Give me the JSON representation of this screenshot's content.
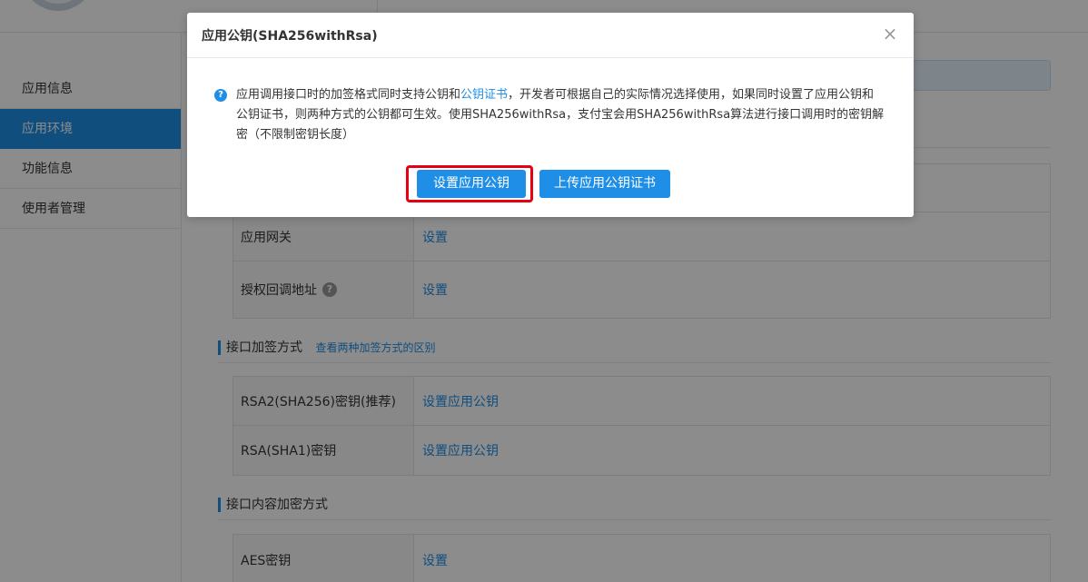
{
  "sidebar": {
    "items": [
      {
        "label": "应用信息",
        "active": false
      },
      {
        "label": "应用环境",
        "active": true
      },
      {
        "label": "功能信息",
        "active": false
      },
      {
        "label": "使用者管理",
        "active": false
      }
    ]
  },
  "main": {
    "gateway_row": {
      "key": "应用网关",
      "value": "设置"
    },
    "callback_row": {
      "key": "授权回调地址",
      "value": "设置",
      "help_icon": "?"
    },
    "sign_section": {
      "title": "接口加签方式",
      "link": "查看两种加签方式的区别",
      "rows": [
        {
          "key": "RSA2(SHA256)密钥(推荐)",
          "value": "设置应用公钥"
        },
        {
          "key": "RSA(SHA1)密钥",
          "value": "设置应用公钥"
        }
      ]
    },
    "encrypt_section": {
      "title": "接口内容加密方式",
      "rows": [
        {
          "key": "AES密钥",
          "value": "设置"
        }
      ]
    }
  },
  "modal": {
    "title": "应用公钥(SHA256withRsa)",
    "close_icon": "×",
    "info_icon": "?",
    "text_before_link": "应用调用接口时的加签格式同时支持公钥和",
    "text_link": "公钥证书",
    "text_after_link": "，开发者可根据自己的实际情况选择使用，如果同时设置了应用公钥和公钥证书，则两种方式的公钥都可生效。使用SHA256withRsa，支付宝会用SHA256withRsa算法进行接口调用时的密钥解密（不限制密钥长度）",
    "btn_set": "设置应用公钥",
    "btn_upload": "上传应用公钥证书"
  },
  "colors": {
    "accent": "#1e8ee6",
    "highlight": "#e60012"
  }
}
